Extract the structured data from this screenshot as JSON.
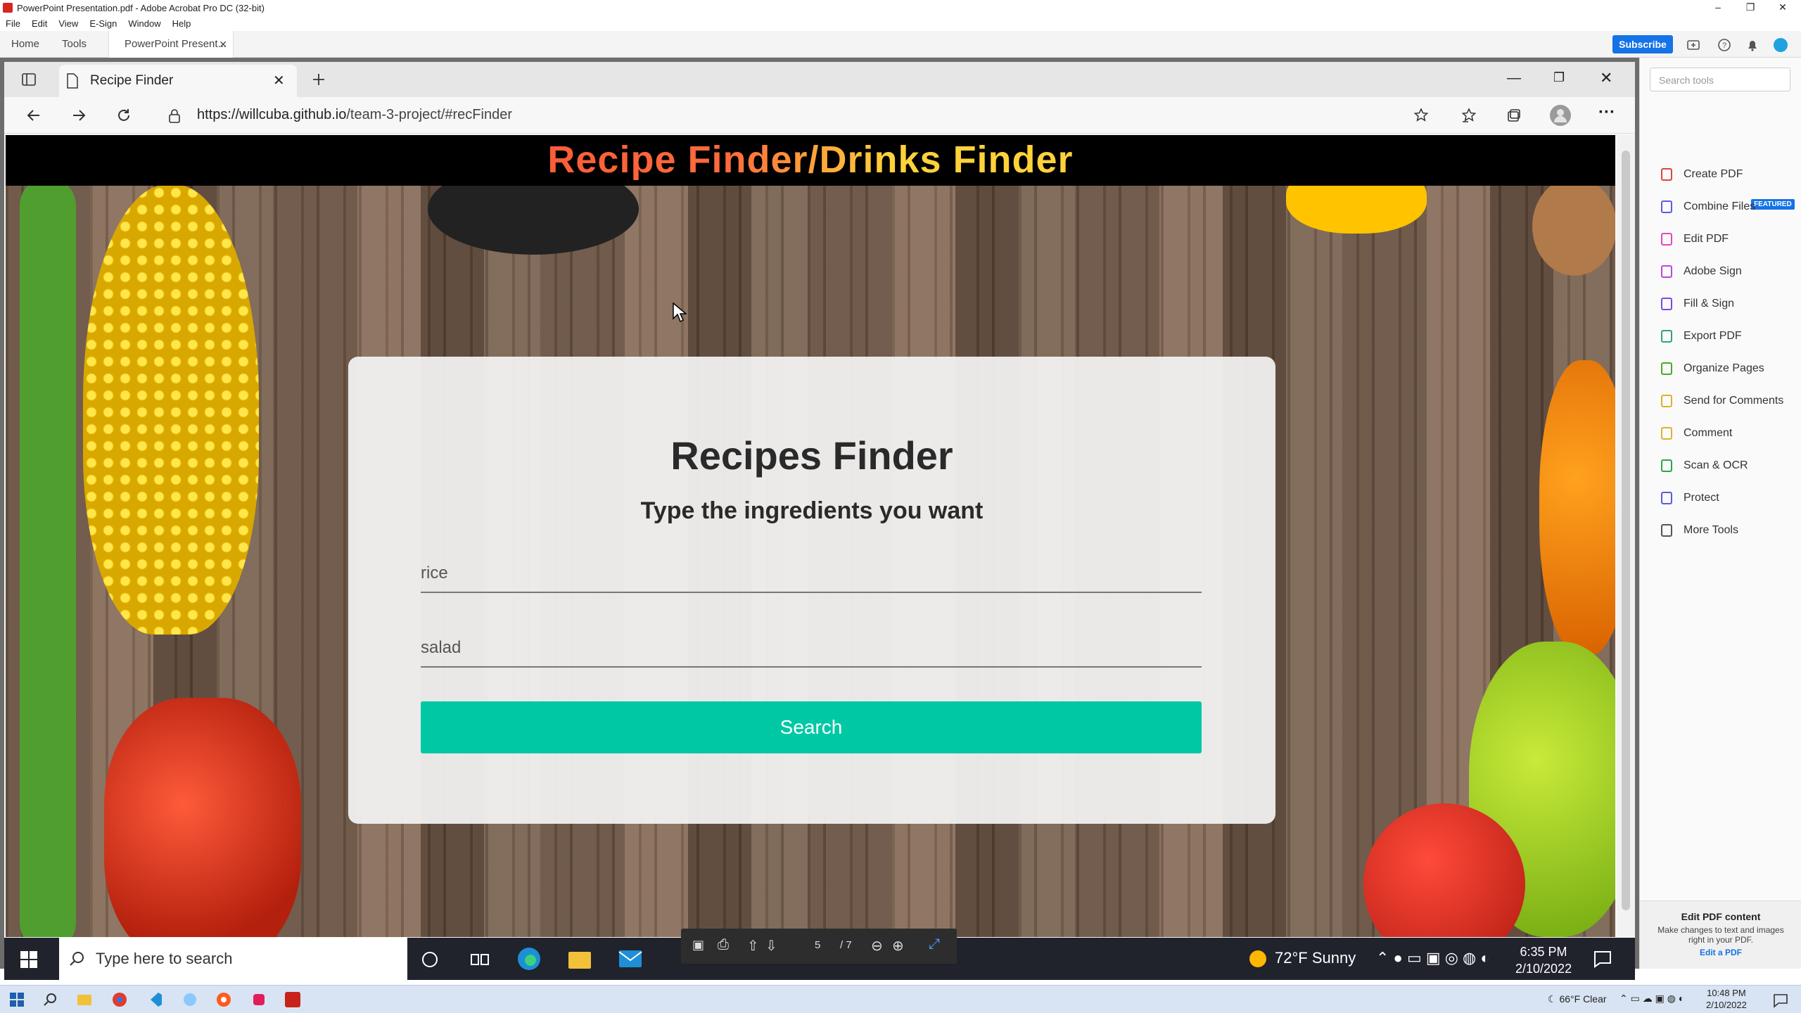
{
  "acrobat": {
    "window_title": "PowerPoint Presentation.pdf - Adobe Acrobat Pro DC (32-bit)",
    "menu": [
      "File",
      "Edit",
      "View",
      "E-Sign",
      "Window",
      "Help"
    ],
    "tabs": {
      "home": "Home",
      "tools": "Tools",
      "document": "PowerPoint Present..."
    },
    "subscribe_label": "Subscribe",
    "tools_search_placeholder": "Search tools",
    "tools": [
      {
        "label": "Create PDF",
        "icon": "create-pdf-icon",
        "color": "#e0443a"
      },
      {
        "label": "Combine Files",
        "icon": "combine-files-icon",
        "color": "#5c5ce0"
      },
      {
        "label": "Edit PDF",
        "icon": "edit-pdf-icon",
        "color": "#e04ab8"
      },
      {
        "label": "Adobe Sign",
        "icon": "adobe-sign-icon",
        "color": "#b54ae0"
      },
      {
        "label": "Fill & Sign",
        "icon": "fill-sign-icon",
        "color": "#7a4ae0"
      },
      {
        "label": "Export PDF",
        "icon": "export-pdf-icon",
        "color": "#2fa37a"
      },
      {
        "label": "Organize Pages",
        "icon": "organize-pages-icon",
        "color": "#4aa82f"
      },
      {
        "label": "Send for Comments",
        "icon": "send-comments-icon",
        "color": "#e0b02f"
      },
      {
        "label": "Comment",
        "icon": "comment-icon",
        "color": "#e0b02f"
      },
      {
        "label": "Scan & OCR",
        "icon": "scan-ocr-icon",
        "color": "#2fa34a"
      },
      {
        "label": "Protect",
        "icon": "protect-icon",
        "color": "#5a5ae0"
      },
      {
        "label": "More Tools",
        "icon": "more-tools-icon",
        "color": "#555555"
      }
    ],
    "featured_badge": "FEATURED",
    "promo": {
      "heading": "Edit PDF content",
      "body": "Make changes to text and images right in your PDF.",
      "link": "Edit a PDF"
    },
    "page_toolbar": {
      "page": "5",
      "total": "/ 7"
    }
  },
  "edge": {
    "tab_title": "Recipe Finder",
    "url_host": "https://willcuba.github.io",
    "url_path": "/team-3-project/#recFinder"
  },
  "site": {
    "header_title": "Recipe Finder/Drinks Finder",
    "card_title": "Recipes Finder",
    "card_subtitle": "Type the ingredients you want",
    "ingredient_1": "rice",
    "ingredient_2": "salad",
    "search_label": "Search",
    "search_color": "#00c8a5"
  },
  "inner_taskbar": {
    "search_placeholder": "Type here to search",
    "weather": "72°F  Sunny",
    "time": "6:35 PM",
    "date": "2/10/2022"
  },
  "outer_taskbar": {
    "weather": "66°F  Clear",
    "time": "10:48 PM",
    "date": "2/10/2022"
  }
}
